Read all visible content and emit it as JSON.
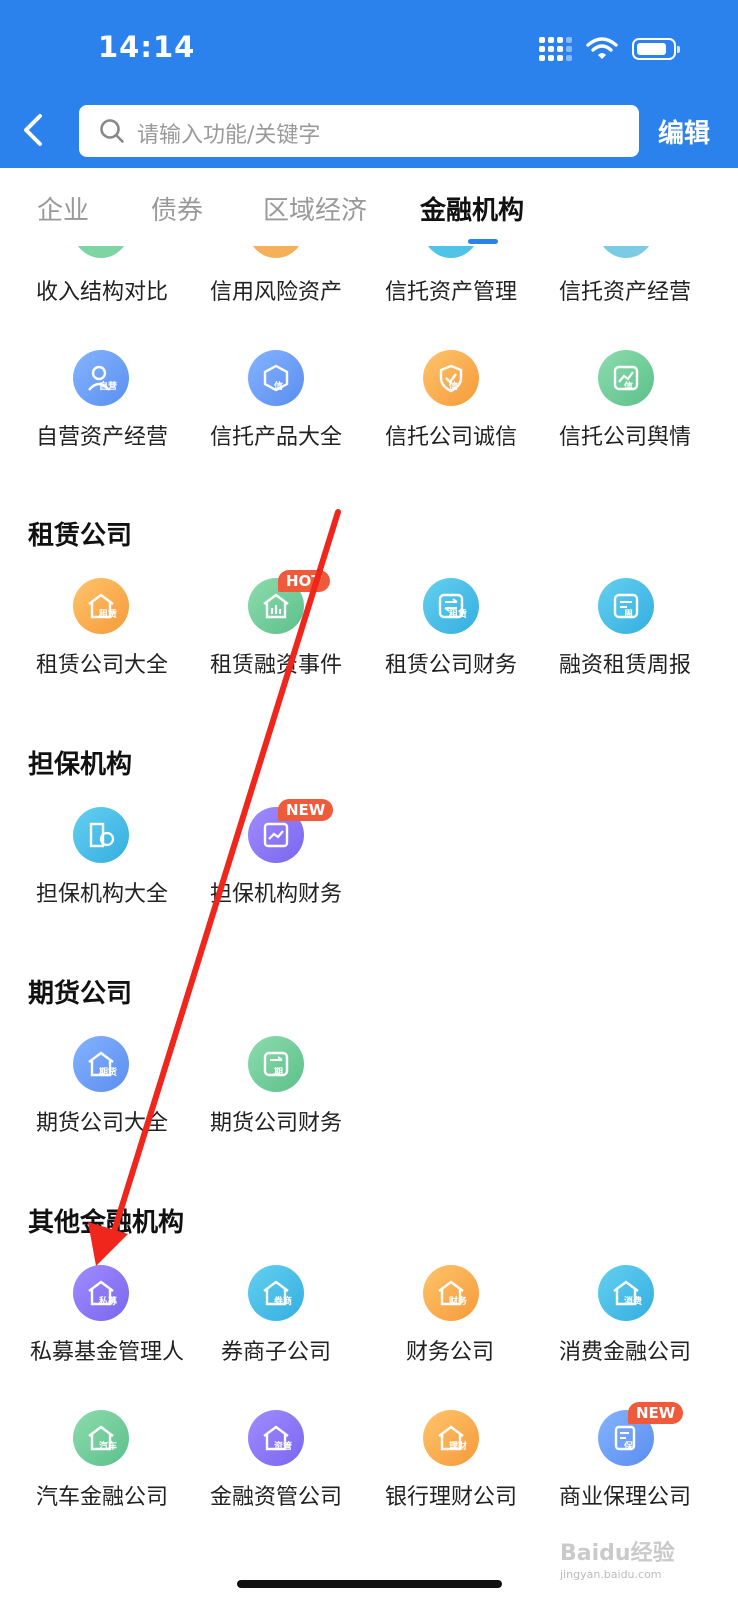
{
  "status_bar": {
    "time": "14:14"
  },
  "header": {
    "search_placeholder": "请输入功能/关键字",
    "edit_label": "编辑"
  },
  "tabs": [
    {
      "label": "企业",
      "active": false
    },
    {
      "label": "债券",
      "active": false
    },
    {
      "label": "区域经济",
      "active": false
    },
    {
      "label": "金融机构",
      "active": true
    }
  ],
  "trust_rows": {
    "row1": [
      "收入结构对比",
      "信用风险资产",
      "信托资产管理",
      "信托资产经营"
    ],
    "row2": [
      "自营资产经营",
      "信托产品大全",
      "信托公司诚信",
      "信托公司舆情"
    ]
  },
  "sections": [
    {
      "title": "租赁公司",
      "items": [
        "租赁公司大全",
        "租赁融资事件",
        "租赁公司财务",
        "融资租赁周报"
      ]
    },
    {
      "title": "担保机构",
      "items": [
        "担保机构大全",
        "担保机构财务"
      ]
    },
    {
      "title": "期货公司",
      "items": [
        "期货公司大全",
        "期货公司财务"
      ]
    },
    {
      "title": "其他金融机构",
      "items": [
        "私募基金管理人",
        "券商子公司",
        "财务公司",
        "消费金融公司",
        "汽车金融公司",
        "金融资管公司",
        "银行理财公司",
        "商业保理公司"
      ]
    }
  ],
  "icon_texts": {
    "self": "自营",
    "product": "信",
    "honesty": "信",
    "sentiment": "信",
    "lease_all": "租赁",
    "lease_fin": "租赁",
    "lease_week": "周",
    "guar_all": "担",
    "fut_all": "期货",
    "fut_fin": "期",
    "pe": "私募",
    "broker": "券商",
    "finance": "财务",
    "consumer": "消费",
    "auto": "汽车",
    "asset": "资管",
    "wealth": "理财",
    "factoring": "保"
  },
  "tags": {
    "hot": "HOT",
    "new1": "NEW",
    "new2": "NEW"
  },
  "watermark": {
    "main": "Baidu经验",
    "sub": "jingyan.baidu.com"
  },
  "colors": {
    "brand_blue": "#2b82ec",
    "tag_red": "#ef5a3a",
    "arrow_red": "#f0261c"
  }
}
